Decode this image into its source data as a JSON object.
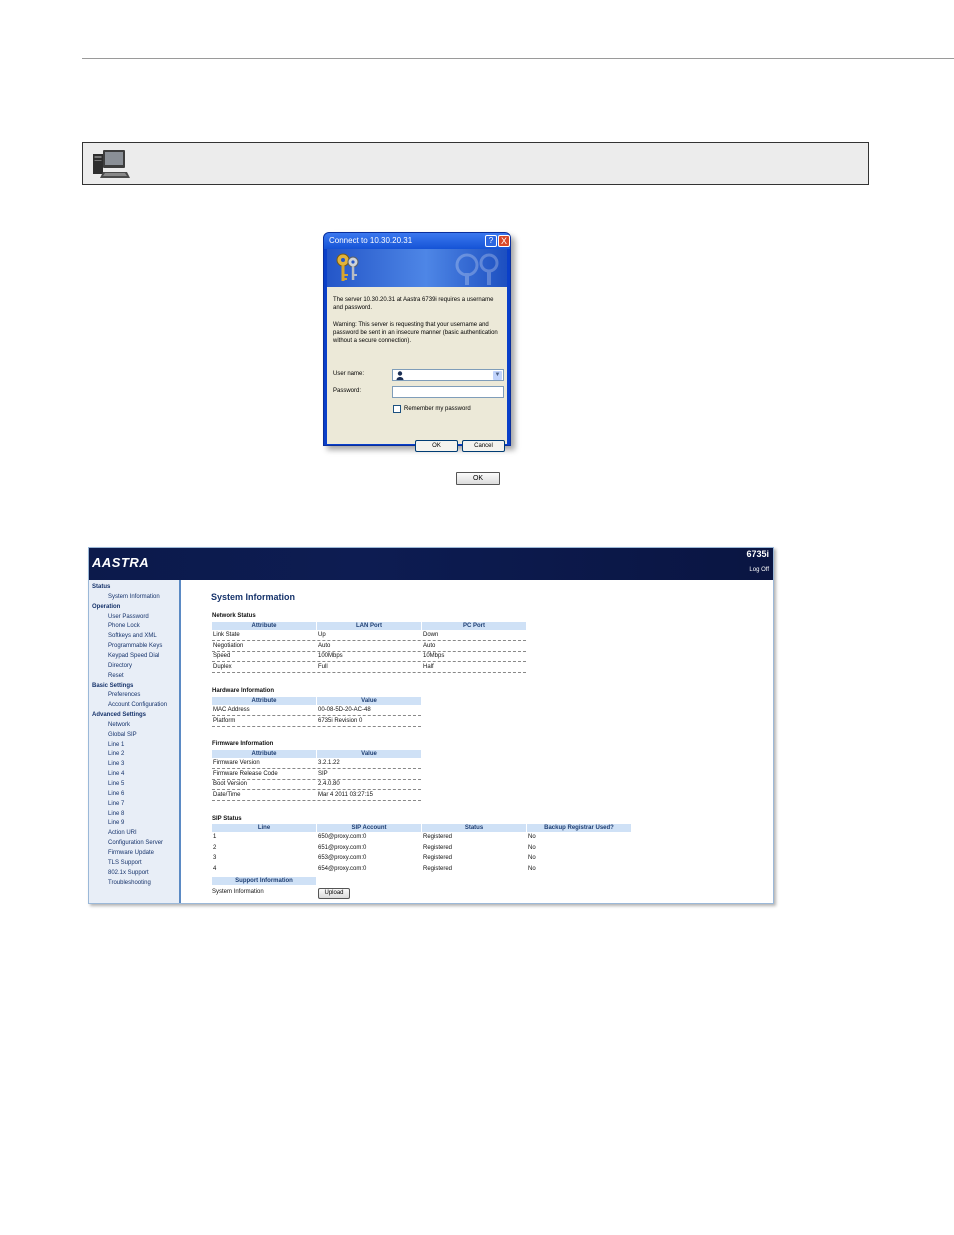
{
  "dialog": {
    "title": "Connect to 10.30.20.31",
    "help": "?",
    "close": "X",
    "message": "The server 10.30.20.31 at Aastra 6739i requires a username and password.",
    "warning": "Warning: This server is requesting that your username and password be sent in an insecure manner (basic authentication without a secure connection).",
    "username_label": "User name:",
    "password_label": "Password:",
    "remember_label": "Remember my password",
    "ok_label": "OK",
    "cancel_label": "Cancel"
  },
  "inline_button": "OK",
  "web": {
    "model": "6735i",
    "logoff": "Log Off",
    "nav": [
      {
        "label": "Status",
        "type": "h"
      },
      {
        "label": "System Information",
        "type": "i"
      },
      {
        "label": "Operation",
        "type": "h"
      },
      {
        "label": "User Password",
        "type": "i"
      },
      {
        "label": "Phone Lock",
        "type": "i"
      },
      {
        "label": "Softkeys and XML",
        "type": "i"
      },
      {
        "label": "Programmable Keys",
        "type": "i"
      },
      {
        "label": "Keypad Speed Dial",
        "type": "i"
      },
      {
        "label": "Directory",
        "type": "i"
      },
      {
        "label": "Reset",
        "type": "i"
      },
      {
        "label": "Basic Settings",
        "type": "h"
      },
      {
        "label": "Preferences",
        "type": "i"
      },
      {
        "label": "Account Configuration",
        "type": "i"
      },
      {
        "label": "Advanced Settings",
        "type": "h"
      },
      {
        "label": "Network",
        "type": "i"
      },
      {
        "label": "Global SIP",
        "type": "i"
      },
      {
        "label": "Line 1",
        "type": "i"
      },
      {
        "label": "Line 2",
        "type": "i"
      },
      {
        "label": "Line 3",
        "type": "i"
      },
      {
        "label": "Line 4",
        "type": "i"
      },
      {
        "label": "Line 5",
        "type": "i"
      },
      {
        "label": "Line 6",
        "type": "i"
      },
      {
        "label": "Line 7",
        "type": "i"
      },
      {
        "label": "Line 8",
        "type": "i"
      },
      {
        "label": "Line 9",
        "type": "i"
      },
      {
        "label": "Action URI",
        "type": "i"
      },
      {
        "label": "Configuration Server",
        "type": "i"
      },
      {
        "label": "Firmware Update",
        "type": "i"
      },
      {
        "label": "TLS Support",
        "type": "i"
      },
      {
        "label": "802.1x Support",
        "type": "i"
      },
      {
        "label": "Troubleshooting",
        "type": "i"
      }
    ],
    "title": "System Information",
    "network": {
      "heading": "Network Status",
      "headers": [
        "Attribute",
        "LAN Port",
        "PC Port"
      ],
      "rows": [
        [
          "Link State",
          "Up",
          "Down"
        ],
        [
          "Negotiation",
          "Auto",
          "Auto"
        ],
        [
          "Speed",
          "100Mbps",
          "10Mbps"
        ],
        [
          "Duplex",
          "Full",
          "Half"
        ]
      ]
    },
    "hardware": {
      "heading": "Hardware Information",
      "headers": [
        "Attribute",
        "Value"
      ],
      "rows": [
        [
          "MAC Address",
          "00-08-5D-20-AC-48"
        ],
        [
          "Platform",
          "6735i Revision 0"
        ]
      ]
    },
    "firmware": {
      "heading": "Firmware Information",
      "headers": [
        "Attribute",
        "Value"
      ],
      "rows": [
        [
          "Firmware Version",
          "3.2.1.22"
        ],
        [
          "Firmware Release Code",
          "SIP"
        ],
        [
          "Boot Version",
          "2.4.0.80"
        ],
        [
          "Date/Time",
          "Mar 4 2011 03:27:15"
        ]
      ]
    },
    "sip": {
      "heading": "SIP Status",
      "headers": [
        "Line",
        "SIP Account",
        "Status",
        "Backup Registrar Used?"
      ],
      "rows": [
        [
          "1",
          "650@proxy.com:0",
          "Registered",
          "No"
        ],
        [
          "2",
          "651@proxy.com:0",
          "Registered",
          "No"
        ],
        [
          "3",
          "653@proxy.com:0",
          "Registered",
          "No"
        ],
        [
          "4",
          "654@proxy.com:0",
          "Registered",
          "No"
        ]
      ]
    },
    "support": {
      "header": "Support Information",
      "label": "System Information",
      "button": "Upload"
    }
  }
}
